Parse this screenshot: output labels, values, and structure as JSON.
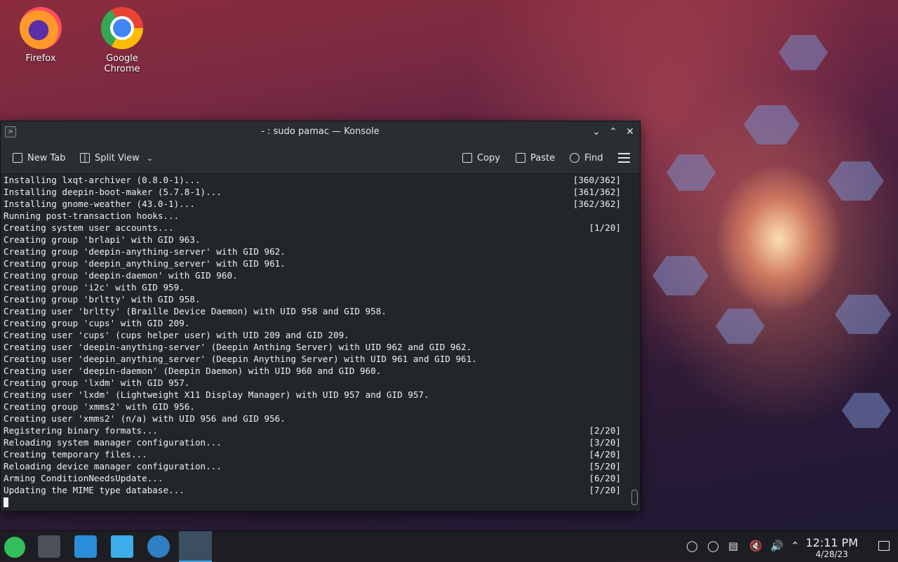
{
  "desktop": {
    "icons": [
      {
        "label": "Firefox",
        "icon": "firefox-icon"
      },
      {
        "label": "Google Chrome",
        "icon": "chrome-icon"
      }
    ]
  },
  "window": {
    "title": "- : sudo pamac — Konsole",
    "toolbar": {
      "new_tab": "New Tab",
      "split_view": "Split View",
      "copy": "Copy",
      "paste": "Paste",
      "find": "Find"
    }
  },
  "terminal": {
    "lines": [
      {
        "text": "Installing lxqt-archiver (0.8.0-1)...",
        "right": "[360/362]"
      },
      {
        "text": "Installing deepin-boot-maker (5.7.8-1)...",
        "right": "[361/362]"
      },
      {
        "text": "Installing gnome-weather (43.0-1)...",
        "right": "[362/362]"
      },
      {
        "text": "Running post-transaction hooks...",
        "right": ""
      },
      {
        "text": "Creating system user accounts...",
        "right": "[1/20]"
      },
      {
        "text": "Creating group 'brlapi' with GID 963.",
        "right": ""
      },
      {
        "text": "Creating group 'deepin-anything-server' with GID 962.",
        "right": ""
      },
      {
        "text": "Creating group 'deepin_anything_server' with GID 961.",
        "right": ""
      },
      {
        "text": "Creating group 'deepin-daemon' with GID 960.",
        "right": ""
      },
      {
        "text": "Creating group 'i2c' with GID 959.",
        "right": ""
      },
      {
        "text": "Creating group 'brltty' with GID 958.",
        "right": ""
      },
      {
        "text": "Creating user 'brltty' (Braille Device Daemon) with UID 958 and GID 958.",
        "right": ""
      },
      {
        "text": "Creating group 'cups' with GID 209.",
        "right": ""
      },
      {
        "text": "Creating user 'cups' (cups helper user) with UID 209 and GID 209.",
        "right": ""
      },
      {
        "text": "Creating user 'deepin-anything-server' (Deepin Anthing Server) with UID 962 and GID 962.",
        "right": ""
      },
      {
        "text": "Creating user 'deepin_anything_server' (Deepin Anything Server) with UID 961 and GID 961.",
        "right": ""
      },
      {
        "text": "Creating user 'deepin-daemon' (Deepin Daemon) with UID 960 and GID 960.",
        "right": ""
      },
      {
        "text": "Creating group 'lxdm' with GID 957.",
        "right": ""
      },
      {
        "text": "Creating user 'lxdm' (Lightweight X11 Display Manager) with UID 957 and GID 957.",
        "right": ""
      },
      {
        "text": "Creating group 'xmms2' with GID 956.",
        "right": ""
      },
      {
        "text": "Creating user 'xmms2' (n/a) with UID 956 and GID 956.",
        "right": ""
      },
      {
        "text": "Registering binary formats...",
        "right": "[2/20]"
      },
      {
        "text": "Reloading system manager configuration...",
        "right": "[3/20]"
      },
      {
        "text": "Creating temporary files...",
        "right": "[4/20]"
      },
      {
        "text": "Reloading device manager configuration...",
        "right": "[5/20]"
      },
      {
        "text": "Arming ConditionNeedsUpdate...",
        "right": "[6/20]"
      },
      {
        "text": "Updating the MIME type database...",
        "right": "[7/20]"
      }
    ]
  },
  "taskbar": {
    "clock_time": "12:11 PM",
    "clock_date": "4/28/23"
  }
}
